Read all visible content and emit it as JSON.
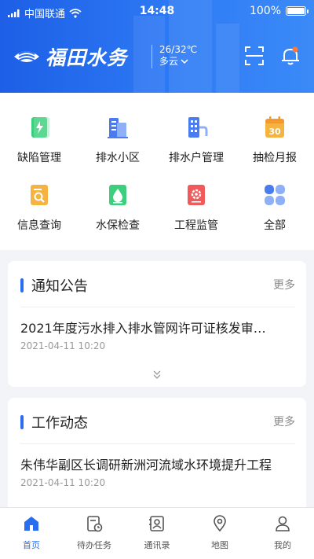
{
  "status_bar": {
    "carrier": "中国联通",
    "time": "14:48",
    "battery": "100%"
  },
  "header": {
    "brand_name": "福田水务",
    "weather_temp": "26/32℃",
    "weather_condition": "多云",
    "scan_icon": "scan-icon",
    "bell_icon": "bell-icon"
  },
  "menu": {
    "items": [
      {
        "label": "缺陷管理",
        "icon": "defect-icon",
        "color": "#3ecf7e"
      },
      {
        "label": "排水小区",
        "icon": "buildings-icon",
        "color": "#4a7cf0"
      },
      {
        "label": "排水户管理",
        "icon": "household-icon",
        "color": "#4a7cf0"
      },
      {
        "label": "抽检月报",
        "icon": "calendar-icon",
        "color": "#f5b342"
      },
      {
        "label": "信息查询",
        "icon": "search-doc-icon",
        "color": "#f5b342"
      },
      {
        "label": "水保检查",
        "icon": "water-drop-icon",
        "color": "#3ecf7e"
      },
      {
        "label": "工程监管",
        "icon": "engineering-icon",
        "color": "#f05a5a"
      },
      {
        "label": "全部",
        "icon": "all-icon",
        "color": "#4a7cf0"
      }
    ]
  },
  "notice": {
    "title": "通知公告",
    "more": "更多",
    "item_title": "2021年度污水排入排水管网许可证核发审…",
    "item_date": "2021-04-11  10:20"
  },
  "news": {
    "title": "工作动态",
    "more": "更多",
    "item_title": "朱伟华副区长调研新洲河流域水环境提升工程",
    "item_date": "2021-04-11  10:20"
  },
  "tabbar": {
    "active_color": "#2a6ef0",
    "items": [
      {
        "label": "首页",
        "icon": "home-icon"
      },
      {
        "label": "待办任务",
        "icon": "task-icon"
      },
      {
        "label": "通讯录",
        "icon": "contacts-icon"
      },
      {
        "label": "地图",
        "icon": "map-pin-icon"
      },
      {
        "label": "我的",
        "icon": "profile-icon"
      }
    ]
  }
}
